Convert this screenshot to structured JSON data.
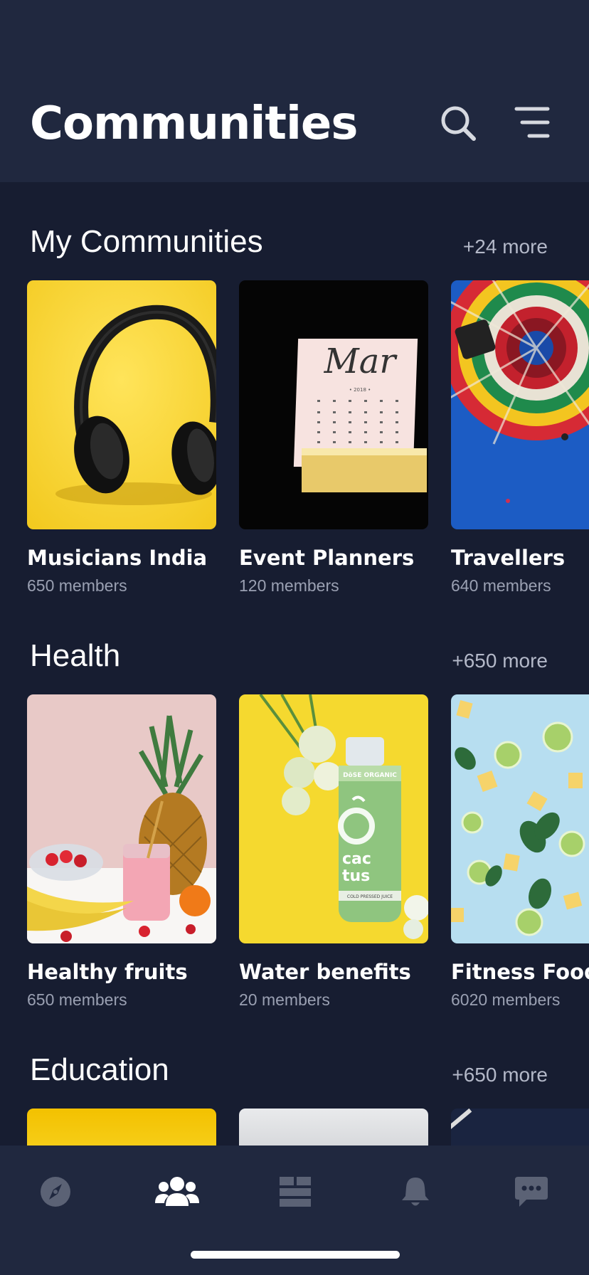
{
  "header": {
    "title": "Communities"
  },
  "sections": [
    {
      "title": "My Communities",
      "more": "+24 more",
      "cards": [
        {
          "name": "Musicians India",
          "members": "650 members"
        },
        {
          "name": "Event Planners",
          "members": "120 members"
        },
        {
          "name": "Travellers",
          "members": "640 members"
        }
      ]
    },
    {
      "title": "Health",
      "more": "+650 more",
      "cards": [
        {
          "name": "Healthy fruits",
          "members": "650 members"
        },
        {
          "name": "Water benefits",
          "members": "20 members"
        },
        {
          "name": "Fitness Food",
          "members": "6020 members"
        }
      ]
    },
    {
      "title": "Education",
      "more": "+650 more"
    }
  ],
  "calendar": {
    "month": "Mar",
    "year": "• 2018 •"
  },
  "bottle": {
    "brand": "DōSE ORGANIC",
    "line1": "cac",
    "line2": "tus",
    "footer": "COLD PRESSED JUICE"
  },
  "tabs": [
    {
      "icon": "compass-icon",
      "active": false
    },
    {
      "icon": "community-icon",
      "active": true
    },
    {
      "icon": "feed-icon",
      "active": false
    },
    {
      "icon": "bell-icon",
      "active": false
    },
    {
      "icon": "chat-icon",
      "active": false
    }
  ],
  "colors": {
    "background": "#171d31",
    "header": "#20283f",
    "muted": "#9aa0b2",
    "inactive_icon": "#5b6275"
  }
}
